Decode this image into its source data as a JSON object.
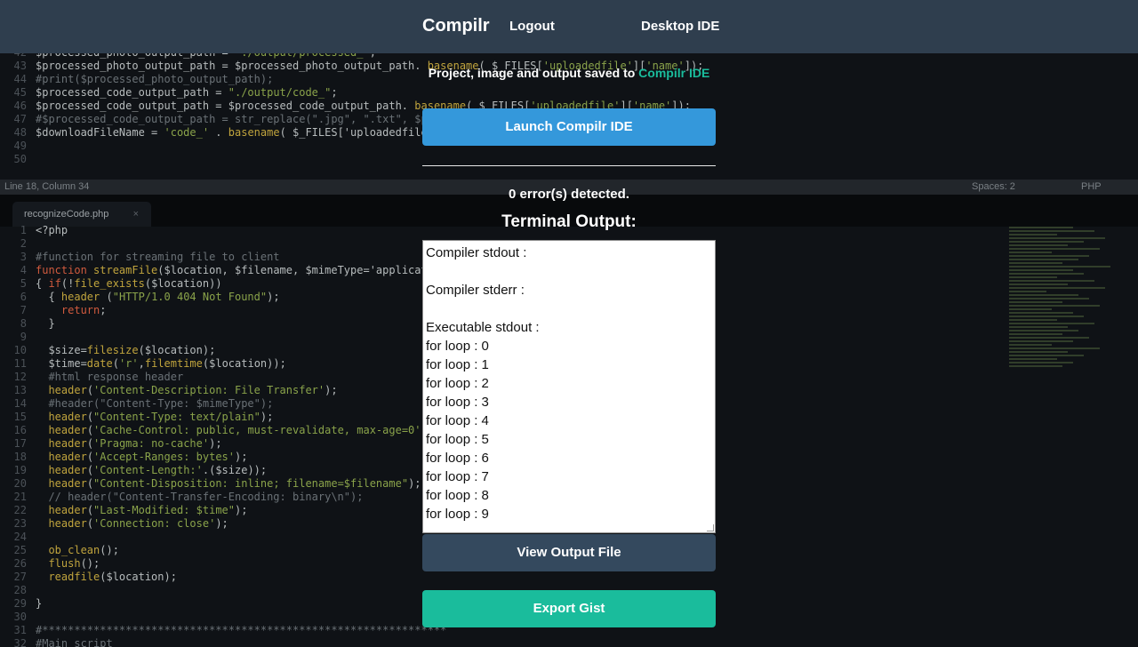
{
  "navbar": {
    "brand": "Compilr",
    "logout": "Logout",
    "desktop_ide": "Desktop IDE"
  },
  "panel": {
    "saved_prefix": "Project, image and output saved to ",
    "saved_link": "Compilr IDE",
    "launch_button": "Launch Compilr IDE",
    "errors_text": "0 error(s) detected.",
    "terminal_heading": "Terminal Output:",
    "terminal_lines": [
      "Compiler stdout :",
      "",
      "Compiler stderr :",
      "",
      "Executable stdout :",
      "for loop : 0",
      "for loop : 1",
      "for loop : 2",
      "for loop : 3",
      "for loop : 4",
      "for loop : 5",
      "for loop : 6",
      "for loop : 7",
      "for loop : 8",
      "for loop : 9"
    ],
    "view_output_button": "View Output File",
    "export_gist_button": "Export Gist"
  },
  "editor": {
    "status_position": "Line 18, Column 34",
    "status_spaces": "Spaces: 2",
    "status_language": "PHP",
    "tab_name": "recognizeCode.php",
    "tab_close": "×",
    "top_lines": [
      {
        "n": "42",
        "t": "$processed_photo_output_path = \"./output/processed_\";"
      },
      {
        "n": "43",
        "t": "$processed_photo_output_path = $processed_photo_output_path. basename( $_FILES['uploadedfile']['name']);"
      },
      {
        "n": "44",
        "t": "#print($processed_photo_output_path);"
      },
      {
        "n": "45",
        "t": "$processed_code_output_path = \"./output/code_\";"
      },
      {
        "n": "46",
        "t": "$processed_code_output_path = $processed_code_output_path. basename( $_FILES['uploadedfile']['name']);"
      },
      {
        "n": "47",
        "t": "#$processed_code_output_path = str_replace(\".jpg\", \".txt\", $p"
      },
      {
        "n": "48",
        "t": "$downloadFileName = 'code_' . basename( $_FILES['uploadedfile"
      },
      {
        "n": "49",
        "t": ""
      },
      {
        "n": "50",
        "t": ""
      }
    ],
    "bottom_lines": [
      {
        "n": "1",
        "t": "<?php"
      },
      {
        "n": "2",
        "t": ""
      },
      {
        "n": "3",
        "t": "#function for streaming file to client"
      },
      {
        "n": "4",
        "t": "function streamFile($location, $filename, $mimeType='applicat"
      },
      {
        "n": "5",
        "t": "{ if(!file_exists($location))"
      },
      {
        "n": "6",
        "t": "  { header (\"HTTP/1.0 404 Not Found\");"
      },
      {
        "n": "7",
        "t": "    return;"
      },
      {
        "n": "8",
        "t": "  }"
      },
      {
        "n": "9",
        "t": ""
      },
      {
        "n": "10",
        "t": "  $size=filesize($location);"
      },
      {
        "n": "11",
        "t": "  $time=date('r',filemtime($location));"
      },
      {
        "n": "12",
        "t": "  #html response header"
      },
      {
        "n": "13",
        "t": "  header('Content-Description: File Transfer');"
      },
      {
        "n": "14",
        "t": "  #header(\"Content-Type: $mimeType\");"
      },
      {
        "n": "15",
        "t": "  header(\"Content-Type: text/plain\");"
      },
      {
        "n": "16",
        "t": "  header('Cache-Control: public, must-revalidate, max-age=0')"
      },
      {
        "n": "17",
        "t": "  header('Pragma: no-cache');"
      },
      {
        "n": "18",
        "t": "  header('Accept-Ranges: bytes');"
      },
      {
        "n": "19",
        "t": "  header('Content-Length:'.($size));"
      },
      {
        "n": "20",
        "t": "  header(\"Content-Disposition: inline; filename=$filename\");"
      },
      {
        "n": "21",
        "t": "  // header(\"Content-Transfer-Encoding: binary\\n\");"
      },
      {
        "n": "22",
        "t": "  header(\"Last-Modified: $time\");"
      },
      {
        "n": "23",
        "t": "  header('Connection: close');"
      },
      {
        "n": "24",
        "t": ""
      },
      {
        "n": "25",
        "t": "  ob_clean();"
      },
      {
        "n": "26",
        "t": "  flush();"
      },
      {
        "n": "27",
        "t": "  readfile($location);"
      },
      {
        "n": "28",
        "t": ""
      },
      {
        "n": "29",
        "t": "}"
      },
      {
        "n": "30",
        "t": ""
      },
      {
        "n": "31",
        "t": "#***************************************************************"
      },
      {
        "n": "32",
        "t": "#Main script"
      }
    ]
  }
}
